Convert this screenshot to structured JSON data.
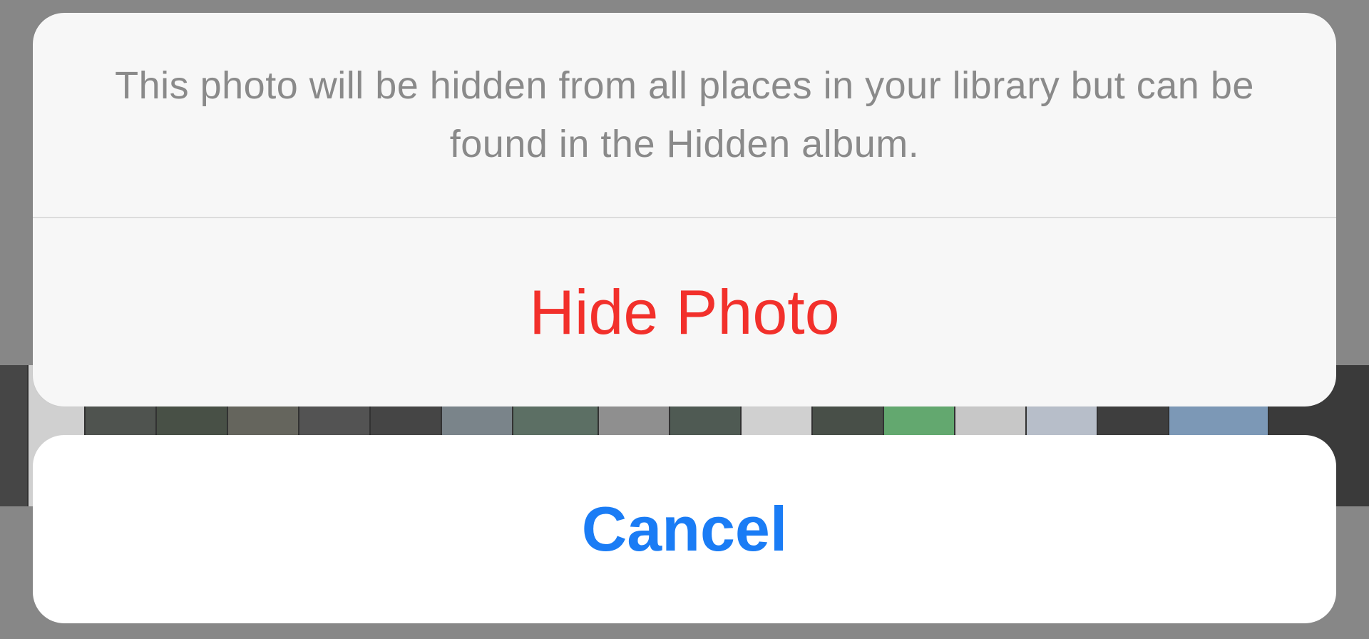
{
  "alert": {
    "message": "This photo will be hidden from all places in your library but can be found in the Hidden album.",
    "primary_action_label": "Hide Photo",
    "cancel_label": "Cancel"
  },
  "colors": {
    "destructive": "#f2302b",
    "cancel": "#1a7cf5",
    "message_text": "#8a8a8a",
    "sheet_background": "#f7f7f7",
    "dim_background": "#8f8f8f"
  },
  "background": {
    "thumbnail_colors": [
      "#2b2b2b",
      "#ffffff",
      "#3a3f3a",
      "#2f3b2c",
      "#5b5b4f",
      "#404040",
      "#2a2a2a",
      "#7b8b94",
      "#4d6b5a",
      "#9b9b9b",
      "#3a4a40",
      "#ffffff",
      "#2e3a2e",
      "#58c26a",
      "#f2f2f2",
      "#d9e4f5",
      "#202020",
      "#7fa9d8"
    ]
  }
}
